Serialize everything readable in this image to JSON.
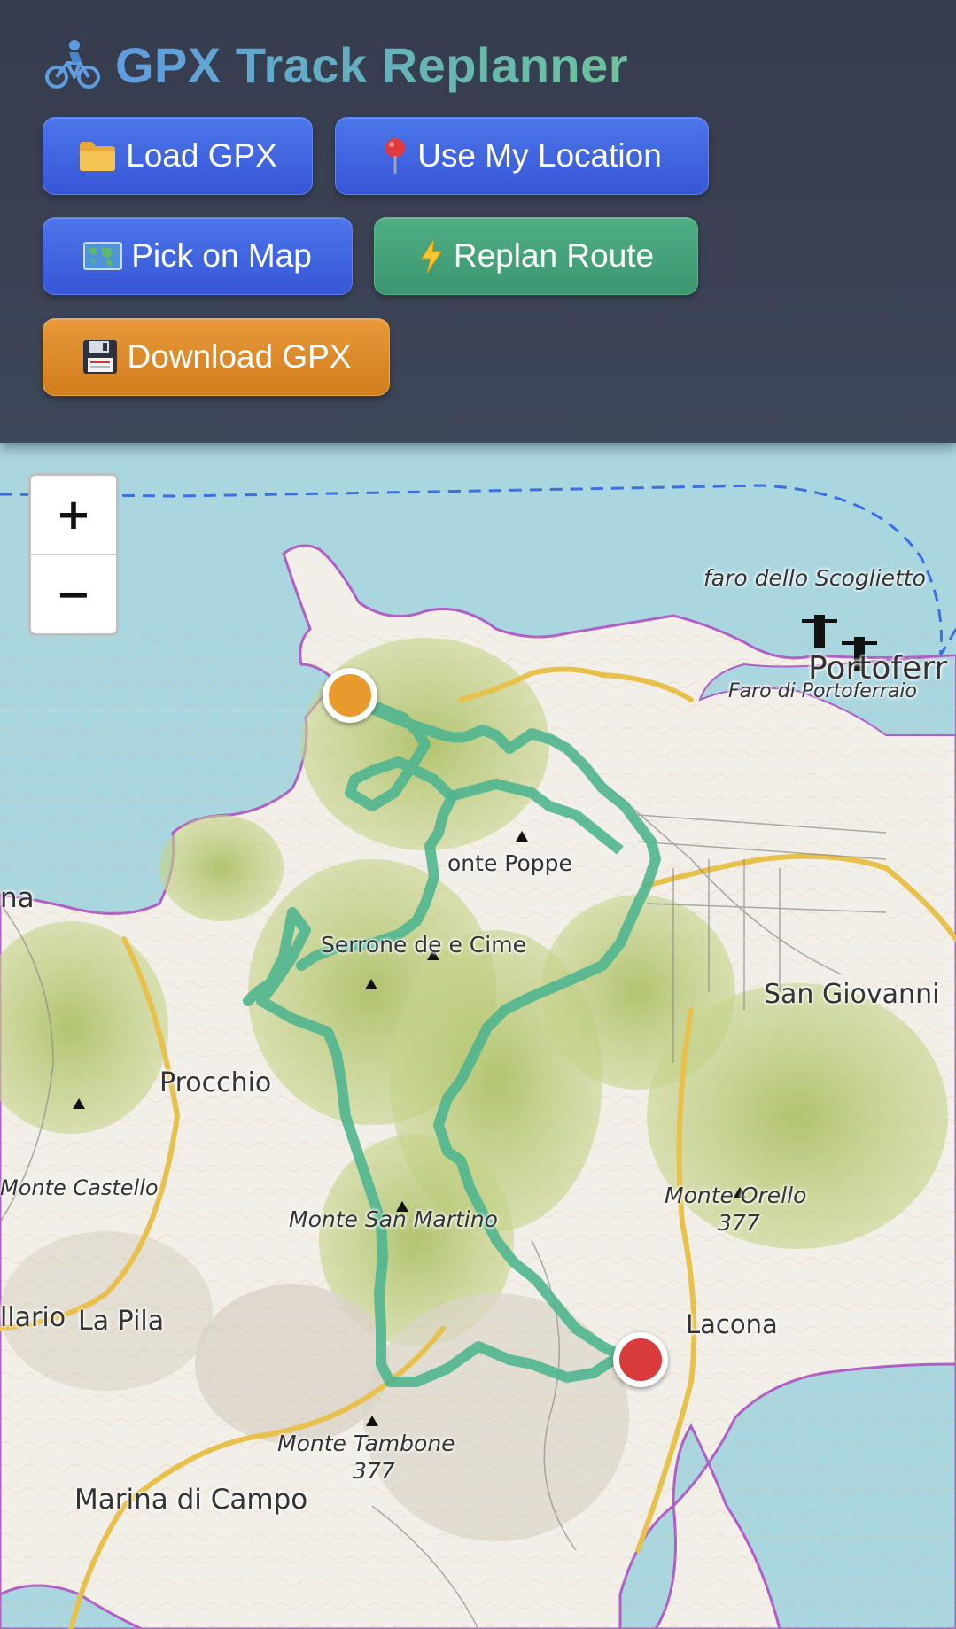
{
  "app": {
    "title": "GPX Track Replanner",
    "title_icon": "bicycle-icon"
  },
  "buttons": {
    "load_gpx": {
      "label": "Load GPX",
      "icon": "folder-icon"
    },
    "use_location": {
      "label": "Use My Location",
      "icon": "pin-icon"
    },
    "pick_on_map": {
      "label": "Pick on Map",
      "icon": "world-map-icon"
    },
    "replan_route": {
      "label": "Replan Route",
      "icon": "lightning-icon"
    },
    "download_gpx": {
      "label": "Download GPX",
      "icon": "floppy-disk-icon"
    }
  },
  "colors": {
    "primary": "#3f63e0",
    "success": "#46a27a",
    "warning": "#e0882a",
    "route": "#4fb58f",
    "start_marker": "#e89a2c",
    "end_marker": "#d93b3b",
    "water": "#a9d8e1"
  },
  "map": {
    "zoom_in": "+",
    "zoom_out": "−",
    "labels": {
      "faro_scoglietto": "faro dello Scoglietto",
      "portoferraio": "Portoferr",
      "faro_portoferraio": "Faro di Portoferraio",
      "monte_poppe": "onte Poppe",
      "serrone": "Serrone de  e Cime",
      "san_giovanni": "San Giovanni",
      "na": "na",
      "procchio": "Procchio",
      "monte_castello": "Monte Castello",
      "monte_san_martino": "Monte San Martino",
      "monte_orello": "Monte Orello",
      "monte_orello_elev": "377",
      "lacona": "Lacona",
      "ilario": "llario",
      "la_pila": "La Pila",
      "monte_tambone": "Monte Tambone",
      "monte_tambone_elev": "377",
      "marina_di_campo": "Marina di Campo"
    }
  }
}
